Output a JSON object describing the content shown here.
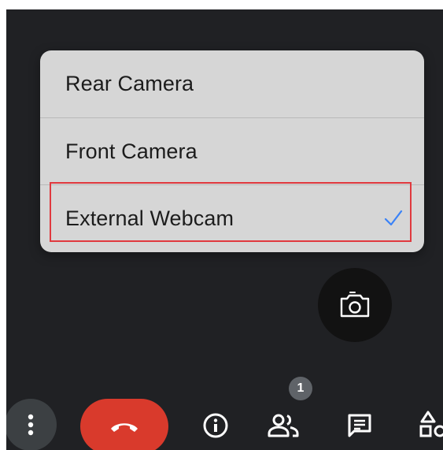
{
  "camera_menu": {
    "items": [
      {
        "label": "Rear Camera",
        "selected": false
      },
      {
        "label": "Front Camera",
        "selected": false
      },
      {
        "label": "External Webcam",
        "selected": true
      }
    ]
  },
  "switch_camera": {
    "icon": "switch-camera-icon"
  },
  "toolbar": {
    "more_icon": "more-vert-icon",
    "hangup_icon": "call-end-icon",
    "info_icon": "info-icon",
    "people_icon": "people-icon",
    "people_count": "1",
    "chat_icon": "chat-icon",
    "activities_icon": "activities-icon"
  },
  "colors": {
    "background": "#202124",
    "menu_background": "#d6d6d6",
    "check_accent": "#3a82f7",
    "hangup_red": "#d93a2c",
    "highlight_red": "#e0393e",
    "icon_white": "#ffffff"
  }
}
